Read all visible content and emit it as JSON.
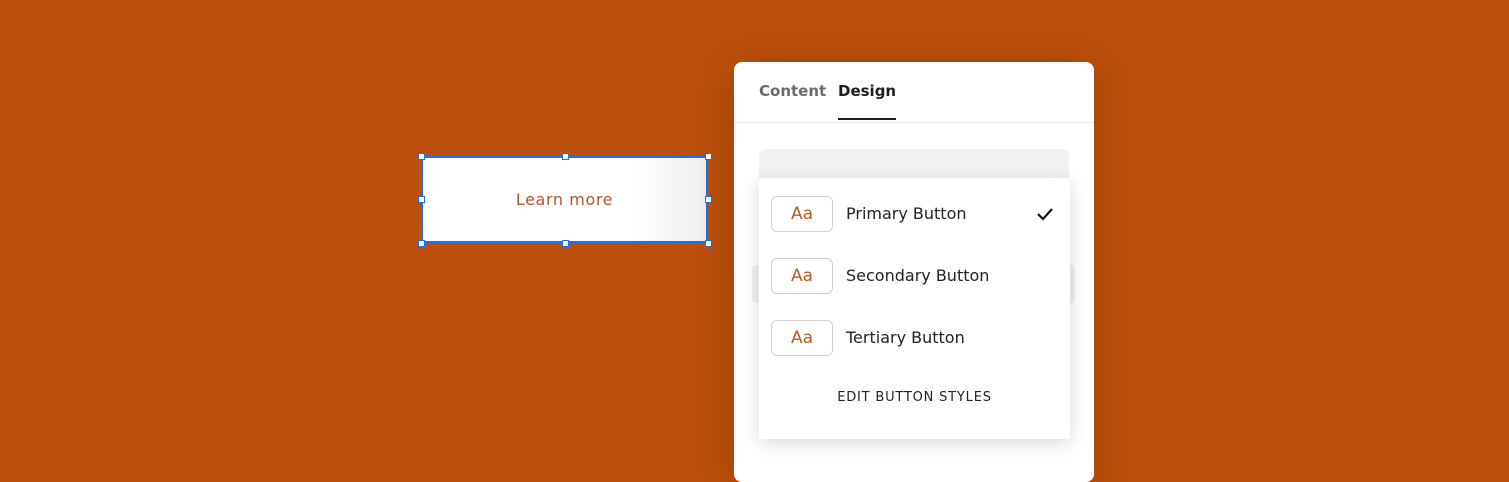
{
  "canvas": {
    "selected_button_label": "Learn more",
    "background_color": "#bc4f0b",
    "accent_color": "#1a73e8"
  },
  "panel": {
    "tabs": [
      {
        "label": "Content",
        "active": false
      },
      {
        "label": "Design",
        "active": true
      }
    ]
  },
  "dropdown": {
    "options": [
      {
        "swatch_text": "Aa",
        "label": "Primary Button",
        "selected": true,
        "icon": "check-icon"
      },
      {
        "swatch_text": "Aa",
        "label": "Secondary Button",
        "selected": false
      },
      {
        "swatch_text": "Aa",
        "label": "Tertiary Button",
        "selected": false
      }
    ],
    "edit_label": "EDIT BUTTON STYLES"
  }
}
